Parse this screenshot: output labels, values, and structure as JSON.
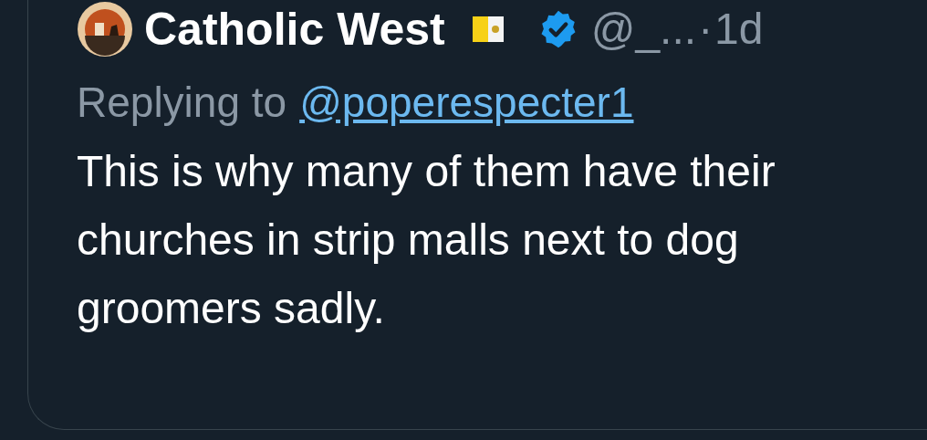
{
  "tweet": {
    "author": {
      "name": "Catholic West",
      "verified": true,
      "handle": "@_...",
      "separator": "·",
      "time": "1d"
    },
    "reply_prefix": "Replying to",
    "reply_link": "@poperespecter1",
    "body": "This is why many of them have their churches in strip malls next to dog groomers sadly."
  }
}
